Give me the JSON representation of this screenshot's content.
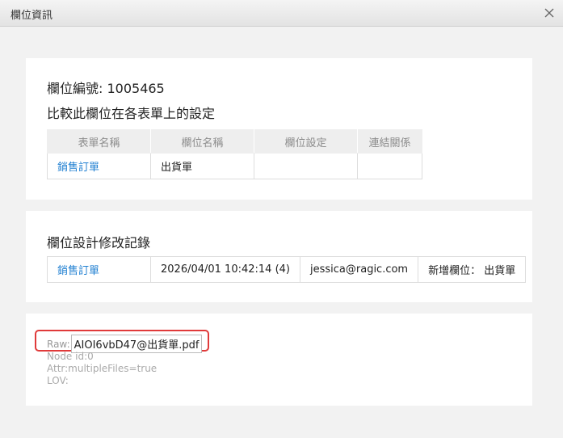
{
  "dialog": {
    "title": "欄位資訊",
    "close_label": "×"
  },
  "field_info": {
    "field_number": "欄位編號: 1005465",
    "compare_title": "比較此欄位在各表單上的設定",
    "columns": [
      "表單名稱",
      "欄位名稱",
      "欄位設定",
      "連結關係"
    ],
    "rows": [
      {
        "form_name": "銷售訂單",
        "field_name": "出貨單",
        "field_setting": "",
        "link_relation": ""
      }
    ]
  },
  "change_log": {
    "title": "欄位設計修改記錄",
    "rows": [
      {
        "form": "銷售訂單",
        "timestamp": "2026/04/01 10:42:14 (4)",
        "user": "jessica@ragic.com",
        "action": "新增欄位： 出貨單"
      }
    ]
  },
  "raw_info": {
    "raw_label": "Raw:",
    "raw_value": "AIOI6vbD47@出貨單.pdf",
    "node_id": "Node id:0",
    "attr": "Attr:multipleFiles=true",
    "lov": "LOV:"
  },
  "colors": {
    "link": "#1f7fd1",
    "highlight": "#e03a3a"
  }
}
